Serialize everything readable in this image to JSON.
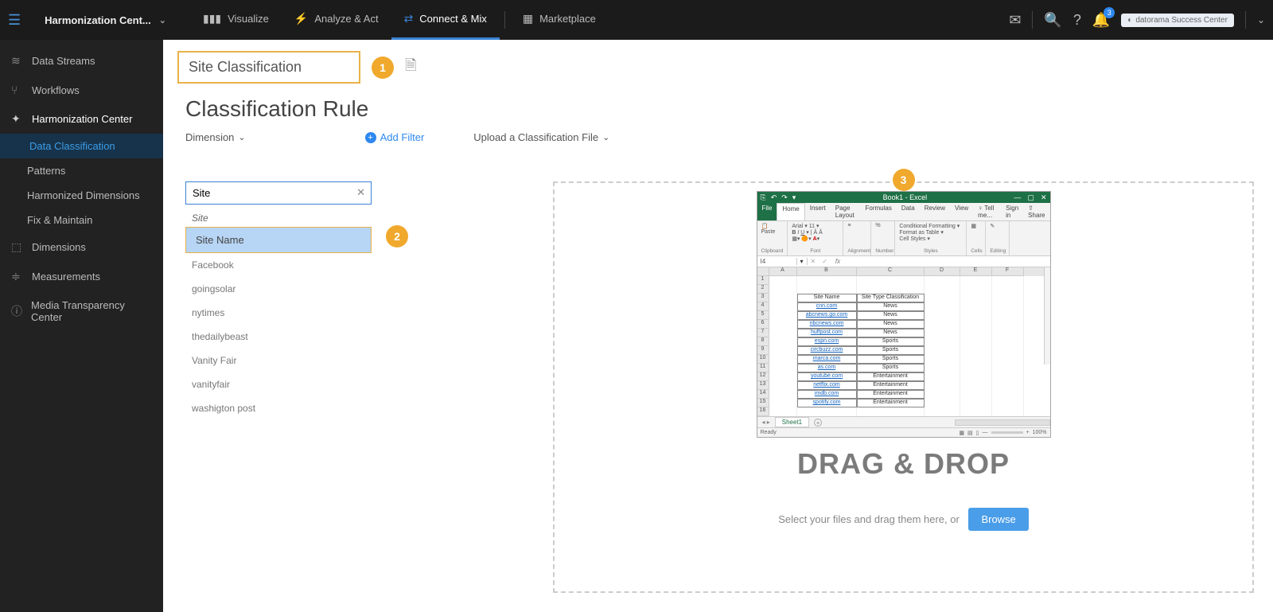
{
  "topbar": {
    "workspace": "Harmonization Cent...",
    "tabs": [
      {
        "label": "Visualize",
        "icon": "bar"
      },
      {
        "label": "Analyze & Act",
        "icon": "bolt"
      },
      {
        "label": "Connect & Mix",
        "icon": "link",
        "active": true
      },
      {
        "label": "Marketplace",
        "icon": "grid"
      }
    ],
    "notification_count": "3",
    "success_center": "datorama  Success Center"
  },
  "sidebar": {
    "items": [
      {
        "label": "Data Streams",
        "icon": "stream"
      },
      {
        "label": "Workflows",
        "icon": "flow"
      },
      {
        "label": "Harmonization Center",
        "icon": "harmony",
        "selected": true,
        "children": [
          {
            "label": "Data Classification",
            "active": true
          },
          {
            "label": "Patterns"
          },
          {
            "label": "Harmonized Dimensions"
          },
          {
            "label": "Fix & Maintain"
          }
        ]
      },
      {
        "label": "Dimensions",
        "icon": "cube"
      },
      {
        "label": "Measurements",
        "icon": "sliders"
      },
      {
        "label": "Media Transparency Center",
        "icon": "info"
      }
    ]
  },
  "main": {
    "title_input": "Site Classification",
    "heading": "Classification Rule",
    "dimension_label": "Dimension",
    "add_filter": "Add Filter",
    "upload_label": "Upload a Classification File",
    "callouts": {
      "one": "1",
      "two": "2",
      "three": "3"
    }
  },
  "dimension_panel": {
    "search_value": "Site",
    "group_heading": "Site",
    "highlighted": "Site Name",
    "options": [
      "Facebook",
      "goingsolar",
      "nytimes",
      "thedailybeast",
      "Vanity Fair",
      "vanityfair",
      "washigton post"
    ]
  },
  "dropzone": {
    "headline": "DRAG & DROP",
    "subline_prefix": "Select your files and drag them here, or",
    "browse": "Browse"
  },
  "excel": {
    "window_title": "Book1 - Excel",
    "qat": [
      "⎘",
      "↶",
      "↷"
    ],
    "menu": [
      "File",
      "Home",
      "Insert",
      "Page Layout",
      "Formulas",
      "Data",
      "Review",
      "View",
      "♀ Tell me...",
      "Sign in",
      "⇪ Share"
    ],
    "active_menu": "Home",
    "ribbon_groups": [
      "Clipboard",
      "Font",
      "Alignment",
      "Number",
      "Styles",
      "Cells",
      "Editing"
    ],
    "font_name": "Arial",
    "font_size": "11",
    "styles_items": [
      "Conditional Formatting ▾",
      "Format as Table ▾",
      "Cell Styles ▾"
    ],
    "cell_ref": "I4",
    "fx_label": "fx",
    "columns": [
      "A",
      "B",
      "C",
      "D",
      "E",
      "F"
    ],
    "row_count": 16,
    "header_row": 3,
    "headers": [
      "Site Name",
      "Site Type Classification"
    ],
    "rows": [
      {
        "b": "cnn.com",
        "c": "News"
      },
      {
        "b": "abcnews.go.com",
        "c": "News"
      },
      {
        "b": "nbcnews.com",
        "c": "News"
      },
      {
        "b": "huffpost.com",
        "c": "News"
      },
      {
        "b": "espn.com",
        "c": "Sports"
      },
      {
        "b": "circbuzz.com",
        "c": "Sports"
      },
      {
        "b": "marca.com",
        "c": "Sports"
      },
      {
        "b": "as.com",
        "c": "Sports"
      },
      {
        "b": "youtube.com",
        "c": "Entertainment"
      },
      {
        "b": "netflix.com",
        "c": "Entertainment"
      },
      {
        "b": "imdb.com",
        "c": "Entertainment"
      },
      {
        "b": "spotify.com",
        "c": "Entertainment"
      }
    ],
    "sheet_name": "Sheet1",
    "status_left": "Ready",
    "zoom": "100%"
  }
}
